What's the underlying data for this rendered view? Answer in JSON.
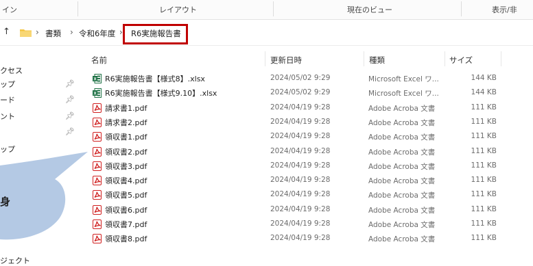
{
  "ribbon": {
    "groups": [
      "イン",
      "レイアウト",
      "現在のビュー",
      "表示/非"
    ]
  },
  "address_bar": {
    "breadcrumbs": [
      "書類",
      "令和6年度",
      "R6実施報告書"
    ],
    "highlight_color": "#c00000"
  },
  "nav_pane": {
    "items": [
      {
        "label": "クセス",
        "pinned": false
      },
      {
        "label": "ップ",
        "pinned": true
      },
      {
        "label": "ード",
        "pinned": true
      },
      {
        "label": "ント",
        "pinned": true
      },
      {
        "label": "",
        "pinned": true
      },
      {
        "label": "ップ",
        "pinned": false
      },
      {
        "label": "ジェクト",
        "pinned": false
      }
    ]
  },
  "callout": {
    "text": "身",
    "fill": "#b4c9e4"
  },
  "columns": {
    "name": "名前",
    "date": "更新日時",
    "type": "種類",
    "size": "サイズ"
  },
  "files": [
    {
      "name": "R6実施報告書【様式8】.xlsx",
      "date": "2024/05/02 9:29",
      "type": "Microsoft Excel ワ...",
      "size": "144 KB",
      "icon": "excel-icon"
    },
    {
      "name": "R6実施報告書【様式9.10】.xlsx",
      "date": "2024/05/02 9:29",
      "type": "Microsoft Excel ワ...",
      "size": "144 KB",
      "icon": "excel-icon"
    },
    {
      "name": "請求書1.pdf",
      "date": "2024/04/19 9:28",
      "type": "Adobe Acroba 文書",
      "size": "111 KB",
      "icon": "pdf-icon"
    },
    {
      "name": "請求書2.pdf",
      "date": "2024/04/19 9:28",
      "type": "Adobe Acroba 文書",
      "size": "111 KB",
      "icon": "pdf-icon"
    },
    {
      "name": "領収書1.pdf",
      "date": "2024/04/19 9:28",
      "type": "Adobe Acroba 文書",
      "size": "111 KB",
      "icon": "pdf-icon"
    },
    {
      "name": "領収書2.pdf",
      "date": "2024/04/19 9:28",
      "type": "Adobe Acroba 文書",
      "size": "111 KB",
      "icon": "pdf-icon"
    },
    {
      "name": "領収書3.pdf",
      "date": "2024/04/19 9:28",
      "type": "Adobe Acroba 文書",
      "size": "111 KB",
      "icon": "pdf-icon"
    },
    {
      "name": "領収書4.pdf",
      "date": "2024/04/19 9:28",
      "type": "Adobe Acroba 文書",
      "size": "111 KB",
      "icon": "pdf-icon"
    },
    {
      "name": "領収書5.pdf",
      "date": "2024/04/19 9:28",
      "type": "Adobe Acroba 文書",
      "size": "111 KB",
      "icon": "pdf-icon"
    },
    {
      "name": "領収書6.pdf",
      "date": "2024/04/19 9:28",
      "type": "Adobe Acroba 文書",
      "size": "111 KB",
      "icon": "pdf-icon"
    },
    {
      "name": "領収書7.pdf",
      "date": "2024/04/19 9:28",
      "type": "Adobe Acroba 文書",
      "size": "111 KB",
      "icon": "pdf-icon"
    },
    {
      "name": "領収書8.pdf",
      "date": "2024/04/19 9:28",
      "type": "Adobe Acroba 文書",
      "size": "111 KB",
      "icon": "pdf-icon"
    }
  ]
}
